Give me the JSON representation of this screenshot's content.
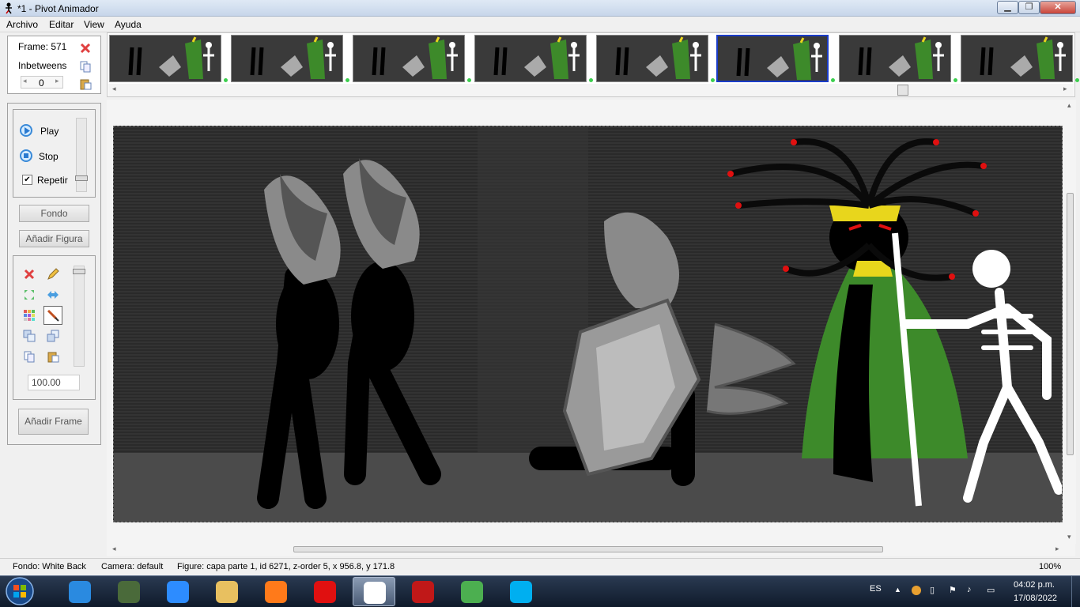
{
  "window": {
    "title": "*1 - Pivot Animador",
    "minimize": "▁",
    "maximize": "❐",
    "close": "✕"
  },
  "menu": {
    "items": [
      "Archivo",
      "Editar",
      "View",
      "Ayuda"
    ]
  },
  "frame_panel": {
    "frame_label": "Frame: 571",
    "inbetweens_label": "Inbetweens",
    "inbetweens_value": "0"
  },
  "playback": {
    "play": "Play",
    "stop": "Stop",
    "repeat": "Repetir",
    "repeat_checked": true
  },
  "buttons": {
    "fondo": "Fondo",
    "add_figure": "Añadir Figura",
    "add_frame": "Añadir Frame"
  },
  "tools": {
    "scale_value": "100.00"
  },
  "filmstrip": {
    "frame_count_visible": 8,
    "selected_index": 5
  },
  "statusbar": {
    "fondo": "Fondo: White Back",
    "camera": "Camera: default",
    "figure": "Figure: capa parte 1,  id 6271,  z-order 5,  x 956.8, y 171.8",
    "zoom": "100%"
  },
  "taskbar": {
    "apps": [
      "start-orb",
      "internet-explorer",
      "minecraft",
      "zoom",
      "file-explorer",
      "firefox",
      "opera",
      "pivot-animator",
      "flash",
      "chrome",
      "skype"
    ],
    "active_app": "pivot-animator",
    "lang": "ES",
    "time": "04:02 p.m.",
    "date": "17/08/2022"
  },
  "colors": {
    "accent": "#1a3cc8",
    "cape": "#3d8a2a",
    "crown": "#e8d61c",
    "eyes": "#e01010"
  }
}
